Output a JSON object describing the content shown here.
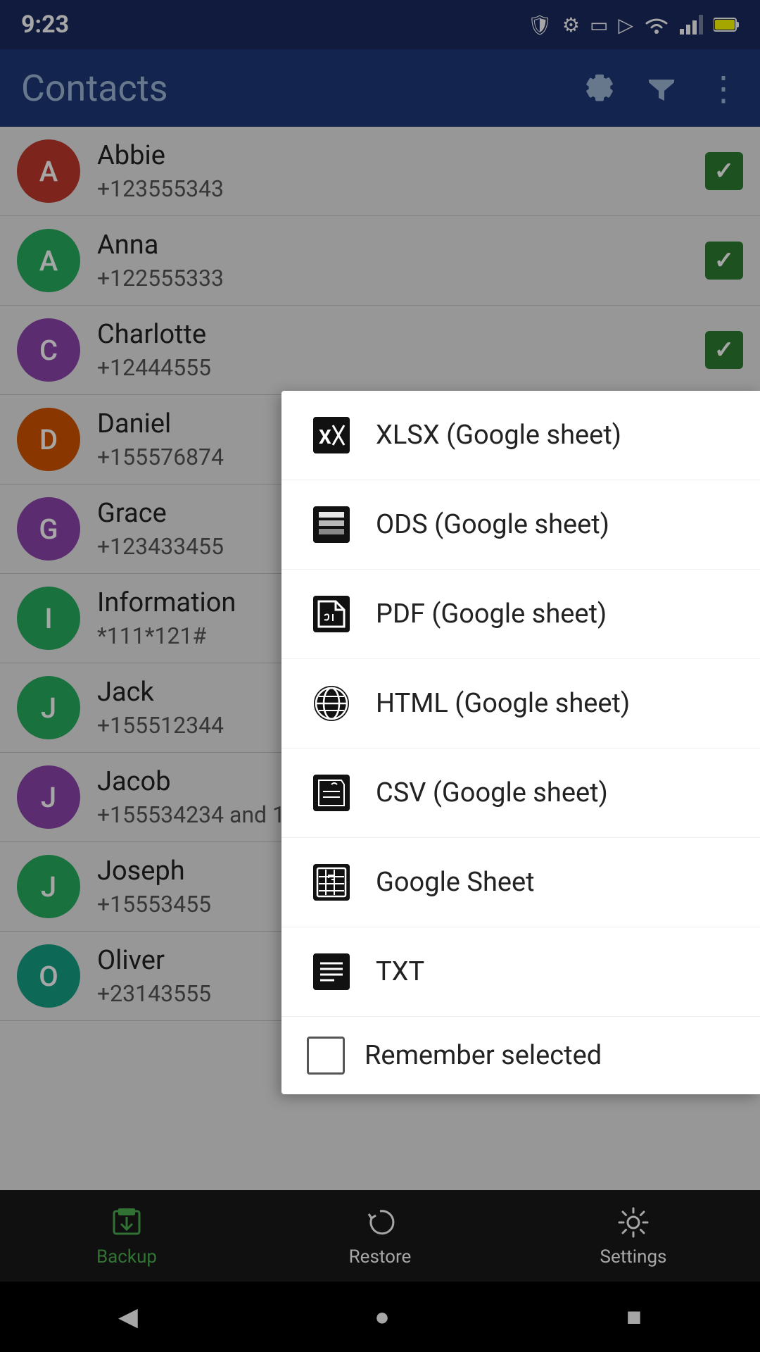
{
  "statusBar": {
    "time": "9:23",
    "icons": [
      "shield",
      "settings",
      "sim",
      "play"
    ]
  },
  "appBar": {
    "title": "Contacts",
    "icons": [
      "gear",
      "filter",
      "more"
    ]
  },
  "contacts": [
    {
      "initial": "A",
      "name": "Abbie",
      "phone": "+123555343",
      "color": "#c0392b",
      "checked": true
    },
    {
      "initial": "A",
      "name": "Anna",
      "phone": "+122555333",
      "color": "#27ae60",
      "checked": true
    },
    {
      "initial": "C",
      "name": "Charlotte",
      "phone": "+12444555",
      "color": "#8e44ad",
      "checked": true
    },
    {
      "initial": "D",
      "name": "Daniel",
      "phone": "+155576874",
      "color": "#d35400",
      "checked": true
    },
    {
      "initial": "G",
      "name": "Grace",
      "phone": "+123433455",
      "color": "#8e44ad",
      "checked": true
    },
    {
      "initial": "I",
      "name": "Information",
      "phone": "*111*121#",
      "color": "#27ae60",
      "checked": true
    },
    {
      "initial": "J",
      "name": "Jack",
      "phone": "+155512344",
      "color": "#27ae60",
      "checked": true
    },
    {
      "initial": "J",
      "name": "Jacob",
      "phone": "+155534234 and 1",
      "color": "#8e44ad",
      "checked": true
    },
    {
      "initial": "J",
      "name": "Joseph",
      "phone": "+15553455",
      "color": "#27ae60",
      "checked": true
    },
    {
      "initial": "O",
      "name": "Oliver",
      "phone": "+23143555",
      "color": "#16a085",
      "checked": true
    }
  ],
  "menu": {
    "items": [
      {
        "id": "xlsx",
        "label": "XLSX (Google sheet)",
        "icon": "xlsx"
      },
      {
        "id": "ods",
        "label": "ODS (Google sheet)",
        "icon": "ods"
      },
      {
        "id": "pdf",
        "label": "PDF (Google sheet)",
        "icon": "pdf"
      },
      {
        "id": "html",
        "label": "HTML (Google sheet)",
        "icon": "html"
      },
      {
        "id": "csv",
        "label": "CSV (Google sheet)",
        "icon": "csv"
      },
      {
        "id": "gsheet",
        "label": "Google Sheet",
        "icon": "gsheet"
      },
      {
        "id": "txt",
        "label": "TXT",
        "icon": "txt"
      }
    ],
    "rememberLabel": "Remember selected",
    "rememberChecked": false
  },
  "bottomNav": [
    {
      "id": "backup",
      "label": "Backup",
      "active": true
    },
    {
      "id": "restore",
      "label": "Restore",
      "active": false
    },
    {
      "id": "settings",
      "label": "Settings",
      "active": false
    }
  ]
}
